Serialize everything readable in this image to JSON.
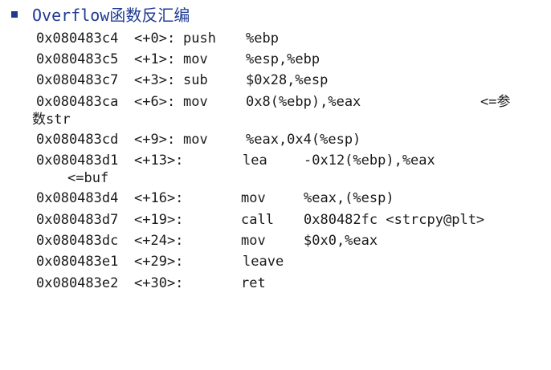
{
  "title": "Overflow函数反汇编",
  "lines": [
    {
      "addr": "0x080483c4",
      "off": "<+0>:",
      "op": "push",
      "args": "%ebp"
    },
    {
      "addr": "0x080483c5",
      "off": "<+1>:",
      "op": "mov",
      "args": "%esp,%ebp"
    },
    {
      "addr": "0x080483c7",
      "off": "<+3>:",
      "op": "sub",
      "args": "$0x28,%esp"
    },
    {
      "addr": "0x080483ca",
      "off": "<+6>:",
      "op": "mov",
      "args": "0x8(%ebp),%eax",
      "comment": "<=参",
      "wrap": "数str"
    },
    {
      "addr": "0x080483cd",
      "off": "<+9>:",
      "op": "mov",
      "args": "%eax,0x4(%esp)"
    },
    {
      "addr": "0x080483d1",
      "off": "<+13>:",
      "op": "lea",
      "args": "-0x12(%ebp),%eax",
      "wrap": "<=buf"
    },
    {
      "addr": "0x080483d4",
      "off": "<+16>:",
      "op": "mov",
      "args": "%eax,(%esp)"
    },
    {
      "addr": "0x080483d7",
      "off": "<+19>:",
      "op": "call",
      "args": "0x80482fc <strcpy@plt>"
    },
    {
      "addr": "0x080483dc",
      "off": "<+24>:",
      "op": "mov",
      "args": "$0x0,%eax"
    },
    {
      "addr": "0x080483e1",
      "off": "<+29>:",
      "op": "leave",
      "args": ""
    },
    {
      "addr": "0x080483e2",
      "off": "<+30>:",
      "op": "ret",
      "args": ""
    }
  ]
}
